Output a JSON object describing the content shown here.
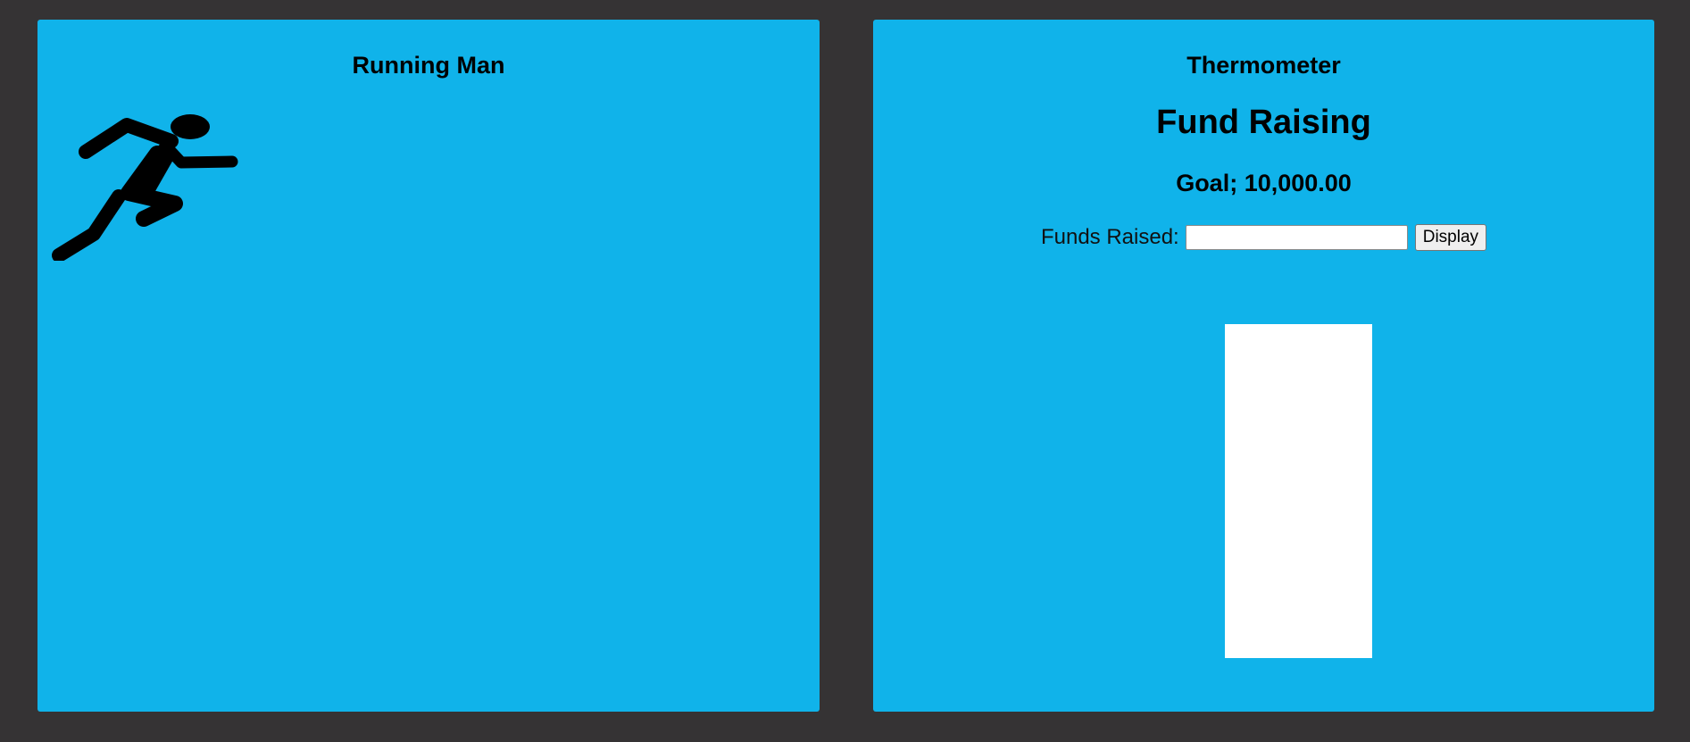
{
  "left_panel": {
    "title": "Running Man",
    "icon": "running-man-icon"
  },
  "right_panel": {
    "title": "Thermometer",
    "heading": "Fund Raising",
    "goal": "Goal; 10,000.00",
    "funds_label": "Funds Raised:",
    "funds_value": "",
    "funds_placeholder": "",
    "display_label": "Display",
    "thermometer_fill_fraction": 0
  },
  "colors": {
    "background": "#353334",
    "panel": "#10b3ea",
    "tube": "#ffffff"
  }
}
